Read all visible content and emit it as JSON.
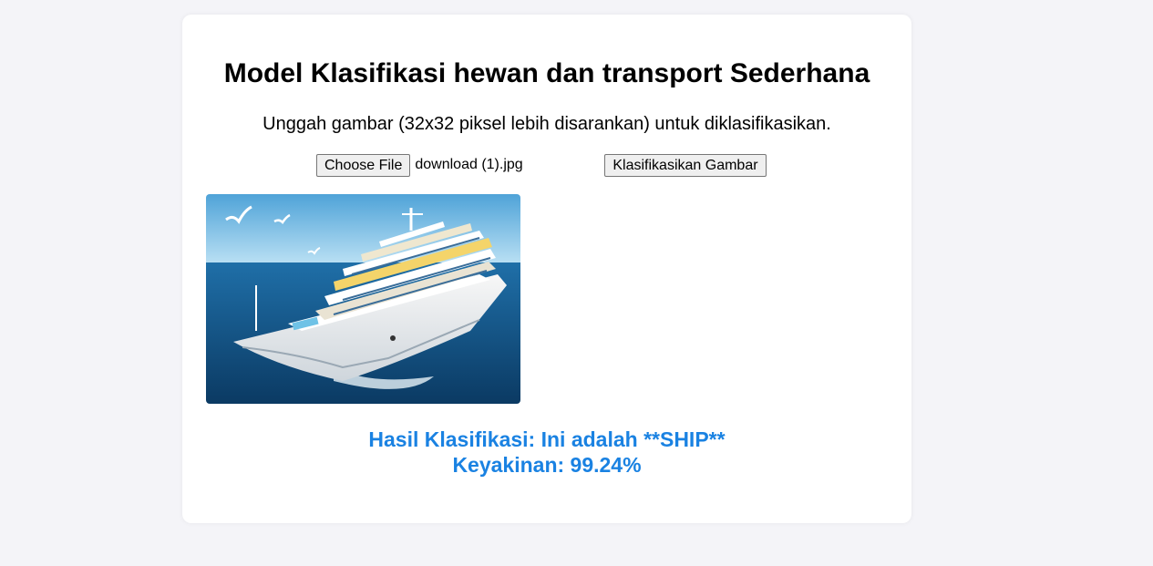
{
  "page": {
    "title": "Model Klasifikasi hewan dan transport Sederhana",
    "instruction": "Unggah gambar (32x32 piksel lebih disarankan) untuk diklasifikasikan."
  },
  "upload": {
    "choose_file_label": "Choose File",
    "file_name": "download (1).jpg",
    "classify_label": "Klasifikasikan Gambar"
  },
  "preview": {
    "icon": "cruise-ship-image"
  },
  "result": {
    "label_line": "Hasil Klasifikasi: Ini adalah **SHIP**",
    "confidence_line": "Keyakinan: 99.24%"
  },
  "colors": {
    "background": "#f4f4f8",
    "card": "#ffffff",
    "result_text": "#1a82e2"
  }
}
